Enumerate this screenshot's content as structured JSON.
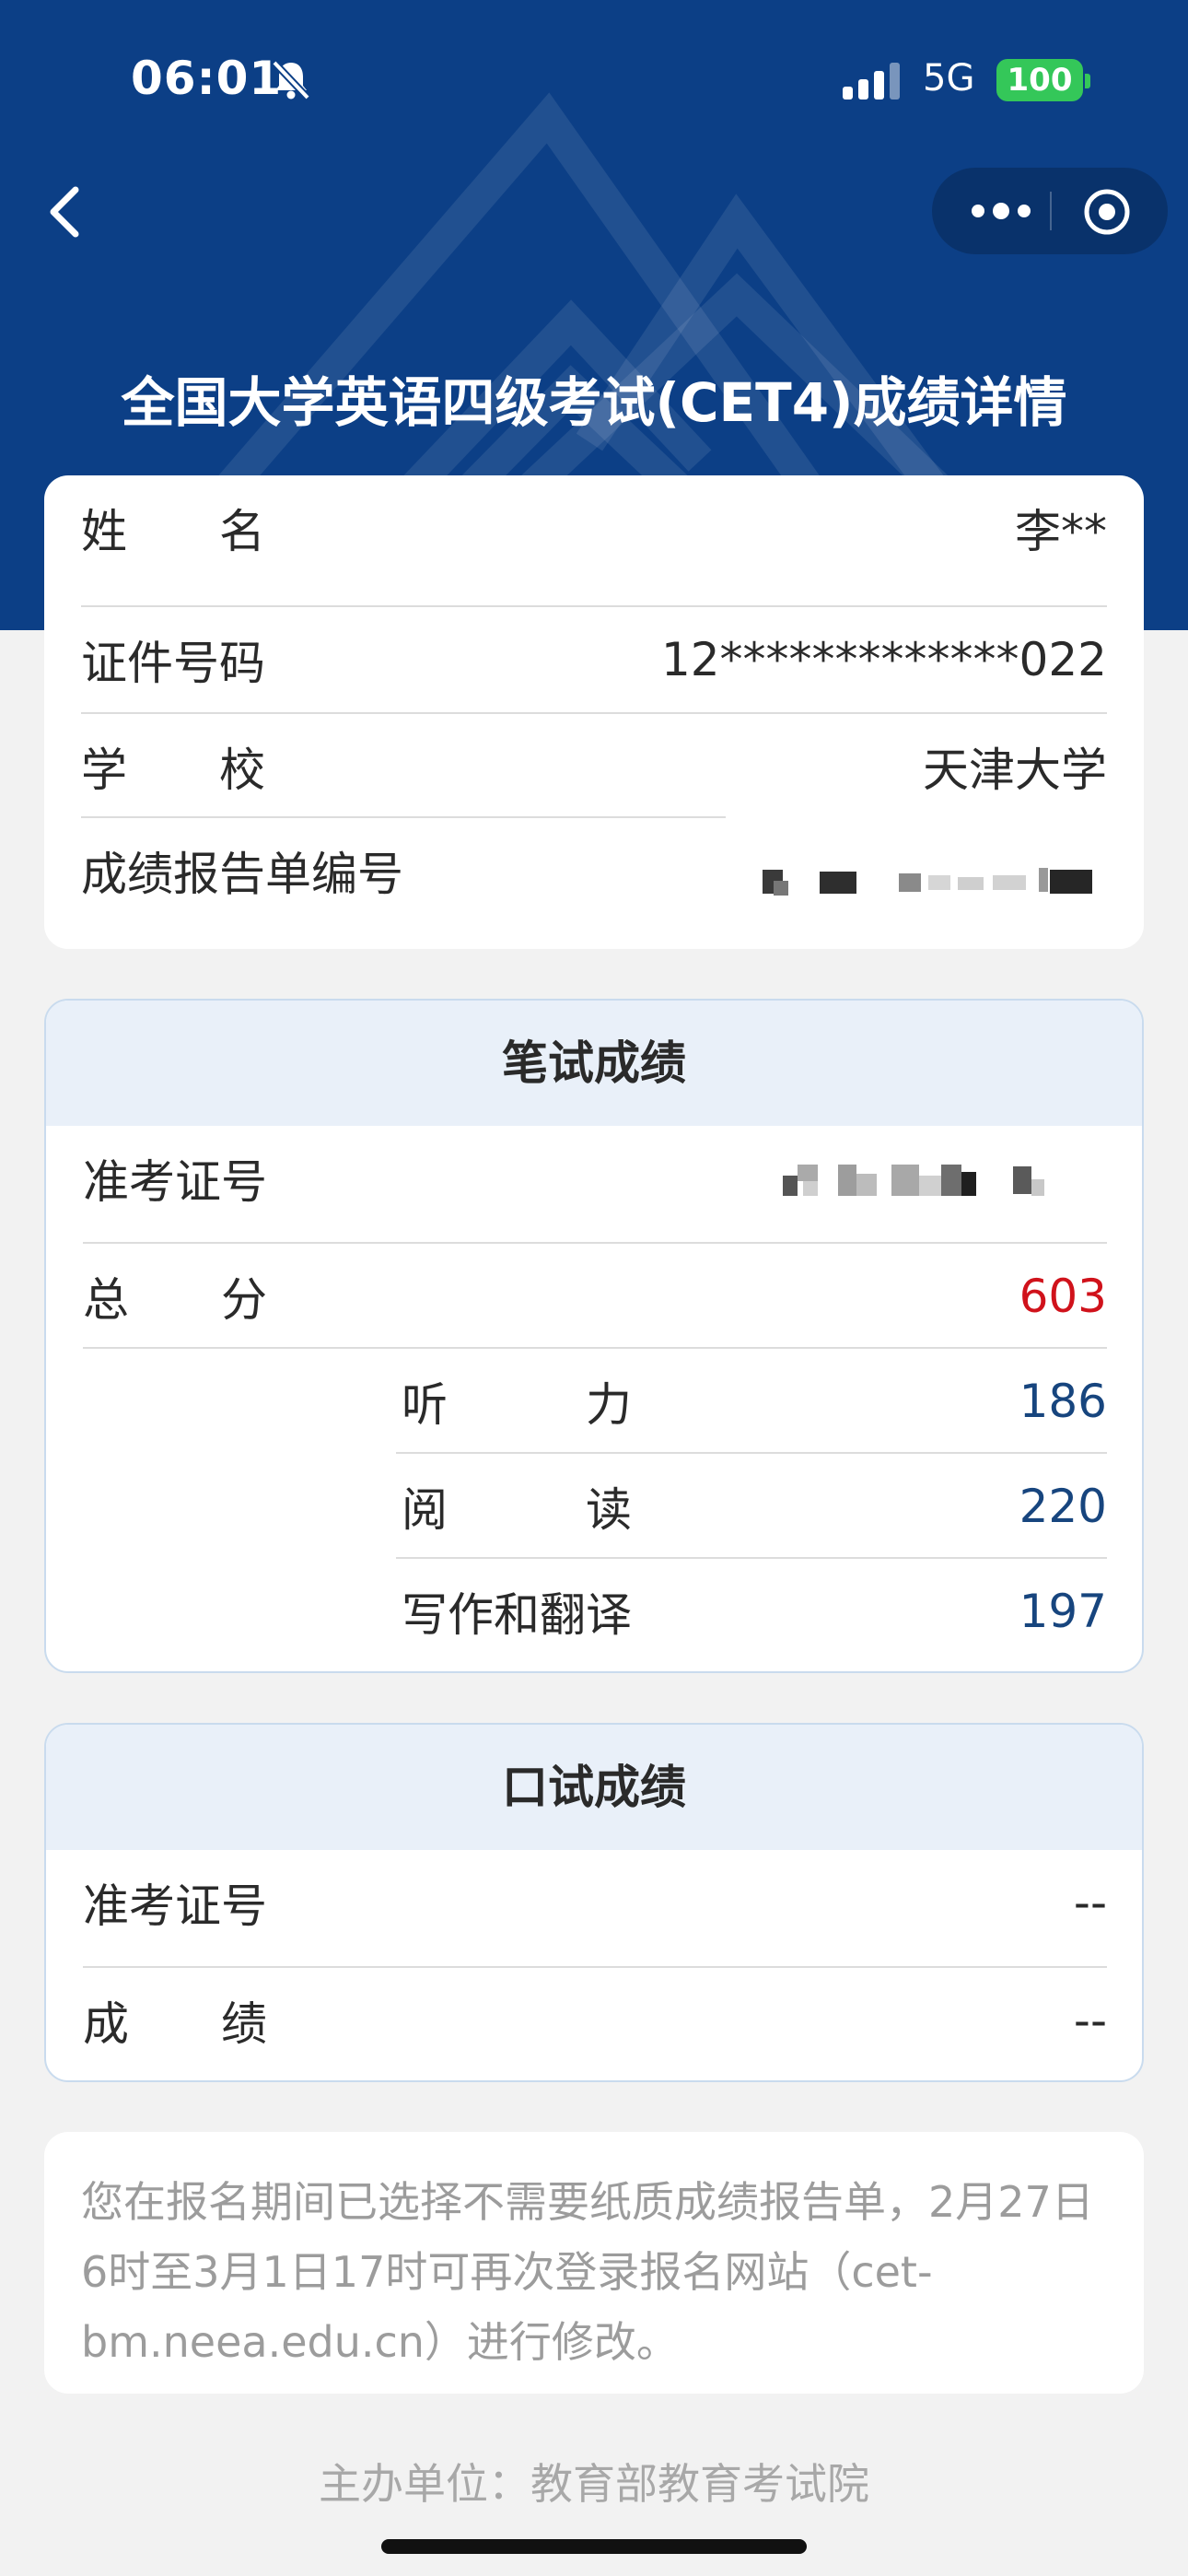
{
  "status_bar": {
    "time": "06:01",
    "network": "5G",
    "battery": "100"
  },
  "header": {
    "title": "全国大学英语四级考试(CET4)成绩详情"
  },
  "personal": {
    "rows": [
      {
        "label": "姓　　名",
        "value": "李**"
      },
      {
        "label": "证件号码",
        "value": "12*************022"
      },
      {
        "label": "学　　校",
        "value": "天津大学"
      },
      {
        "label": "成绩报告单编号",
        "value": ""
      }
    ]
  },
  "written": {
    "header": "笔试成绩",
    "admission_label": "准考证号",
    "admission_value": "",
    "admission_tail": "5",
    "total_label": "总　　分",
    "total_value": "603",
    "sub_scores": [
      {
        "label": "听　　　力",
        "value": "186"
      },
      {
        "label": "阅　　　读",
        "value": "220"
      },
      {
        "label": "写作和翻译",
        "value": "197"
      }
    ]
  },
  "oral": {
    "header": "口试成绩",
    "admission_label": "准考证号",
    "admission_value": "--",
    "score_label": "成　　绩",
    "score_value": "--"
  },
  "note": {
    "text": "您在报名期间已选择不需要纸质成绩报告单，2月27日6时至3月1日17时可再次登录报名网站（cet-bm.neea.edu.cn）进行修改。"
  },
  "footer": {
    "text": "主办单位：教育部教育考试院"
  },
  "colors": {
    "header_bg": "#0c3f86",
    "total_score": "#d0121b",
    "sub_score": "#17457e",
    "section_header_bg": "#e9f0f9"
  }
}
